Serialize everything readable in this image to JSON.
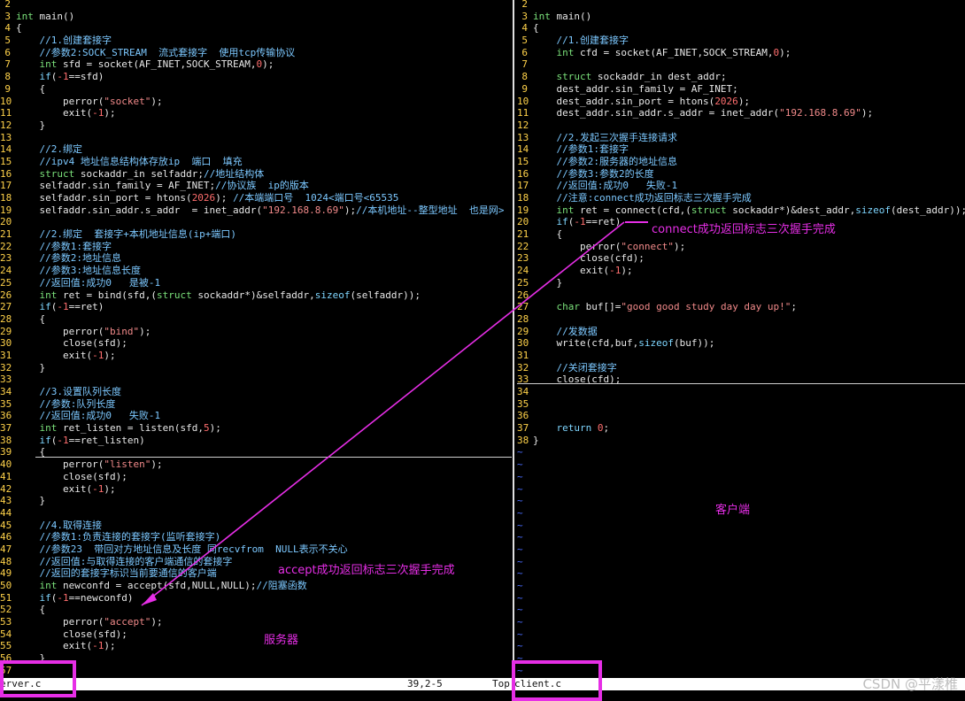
{
  "left": {
    "lines": [
      {
        "n": "2",
        "t": ""
      },
      {
        "n": "3",
        "t": "int main()"
      },
      {
        "n": "4",
        "t": "{"
      },
      {
        "n": "5",
        "t": "    //1.创建套接字"
      },
      {
        "n": "6",
        "t": "    //参数2:SOCK_STREAM  流式套接字  使用tcp传输协议"
      },
      {
        "n": "7",
        "t": "    int sfd = socket(AF_INET,SOCK_STREAM,0);"
      },
      {
        "n": "8",
        "t": "    if(-1==sfd)"
      },
      {
        "n": "9",
        "t": "    {"
      },
      {
        "n": "10",
        "t": "        perror(\"socket\");"
      },
      {
        "n": "11",
        "t": "        exit(-1);"
      },
      {
        "n": "12",
        "t": "    }"
      },
      {
        "n": "13",
        "t": ""
      },
      {
        "n": "14",
        "t": "    //2.绑定"
      },
      {
        "n": "15",
        "t": "    //ipv4 地址信息结构体存放ip  端口  填充"
      },
      {
        "n": "16",
        "t": "    struct sockaddr_in selfaddr;//地址结构体"
      },
      {
        "n": "17",
        "t": "    selfaddr.sin_family = AF_INET;//协议族  ip的版本"
      },
      {
        "n": "18",
        "t": "    selfaddr.sin_port = htons(2026); //本端端口号  1024<端口号<65535"
      },
      {
        "n": "19",
        "t": "    selfaddr.sin_addr.s_addr  = inet_addr(\"192.168.8.69\");//本机地址--整型地址  也是网>"
      },
      {
        "n": "20",
        "t": ""
      },
      {
        "n": "21",
        "t": "    //2.绑定  套接字+本机地址信息(ip+端口)"
      },
      {
        "n": "22",
        "t": "    //参数1:套接字"
      },
      {
        "n": "23",
        "t": "    //参数2:地址信息"
      },
      {
        "n": "24",
        "t": "    //参数3:地址信息长度"
      },
      {
        "n": "25",
        "t": "    //返回值:成功0   是被-1"
      },
      {
        "n": "26",
        "t": "    int ret = bind(sfd,(struct sockaddr*)&selfaddr,sizeof(selfaddr));"
      },
      {
        "n": "27",
        "t": "    if(-1==ret)"
      },
      {
        "n": "28",
        "t": "    {"
      },
      {
        "n": "29",
        "t": "        perror(\"bind\");"
      },
      {
        "n": "30",
        "t": "        close(sfd);"
      },
      {
        "n": "31",
        "t": "        exit(-1);"
      },
      {
        "n": "32",
        "t": "    }"
      },
      {
        "n": "33",
        "t": ""
      },
      {
        "n": "34",
        "t": "    //3.设置队列长度"
      },
      {
        "n": "35",
        "t": "    //参数:队列长度"
      },
      {
        "n": "36",
        "t": "    //返回值:成功0   失败-1"
      },
      {
        "n": "37",
        "t": "    int ret_listen = listen(sfd,5);"
      },
      {
        "n": "38",
        "t": "    if(-1==ret_listen)"
      },
      {
        "n": "39",
        "t": "    {"
      },
      {
        "n": "40",
        "t": "        perror(\"listen\");"
      },
      {
        "n": "41",
        "t": "        close(sfd);"
      },
      {
        "n": "42",
        "t": "        exit(-1);"
      },
      {
        "n": "43",
        "t": "    }"
      },
      {
        "n": "44",
        "t": ""
      },
      {
        "n": "45",
        "t": "    //4.取得连接"
      },
      {
        "n": "46",
        "t": "    //参数1:负责连接的套接字(监听套接字)"
      },
      {
        "n": "47",
        "t": "    //参数23  带回对方地址信息及长度 同recvfrom  NULL表示不关心"
      },
      {
        "n": "48",
        "t": "    //返回值:与取得连接的客户端通信的套接字"
      },
      {
        "n": "49",
        "t": "    //返回的套接字标识当前要通信的客户端"
      },
      {
        "n": "50",
        "t": "    int newconfd = accept(sfd,NULL,NULL);//阻塞函数"
      },
      {
        "n": "51",
        "t": "    if(-1==newconfd)"
      },
      {
        "n": "52",
        "t": "    {"
      },
      {
        "n": "53",
        "t": "        perror(\"accept\");"
      },
      {
        "n": "54",
        "t": "        close(sfd);"
      },
      {
        "n": "55",
        "t": "        exit(-1);"
      },
      {
        "n": "56",
        "t": "    }"
      },
      {
        "n": "57",
        "t": ""
      }
    ]
  },
  "right": {
    "lines": [
      {
        "n": "2",
        "t": ""
      },
      {
        "n": "3",
        "t": "int main()"
      },
      {
        "n": "4",
        "t": "{"
      },
      {
        "n": "5",
        "t": "    //1.创建套接字"
      },
      {
        "n": "6",
        "t": "    int cfd = socket(AF_INET,SOCK_STREAM,0);"
      },
      {
        "n": "7",
        "t": ""
      },
      {
        "n": "8",
        "t": "    struct sockaddr_in dest_addr;"
      },
      {
        "n": "9",
        "t": "    dest_addr.sin_family = AF_INET;"
      },
      {
        "n": "10",
        "t": "    dest_addr.sin_port = htons(2026);"
      },
      {
        "n": "11",
        "t": "    dest_addr.sin_addr.s_addr = inet_addr(\"192.168.8.69\");"
      },
      {
        "n": "12",
        "t": ""
      },
      {
        "n": "13",
        "t": "    //2.发起三次握手连接请求"
      },
      {
        "n": "14",
        "t": "    //参数1:套接字"
      },
      {
        "n": "15",
        "t": "    //参数2:服务器的地址信息"
      },
      {
        "n": "16",
        "t": "    //参数3:参数2的长度"
      },
      {
        "n": "17",
        "t": "    //返回值:成功0   失败-1"
      },
      {
        "n": "18",
        "t": "    //注意:connect成功返回标志三次握手完成"
      },
      {
        "n": "19",
        "t": "    int ret = connect(cfd,(struct sockaddr*)&dest_addr,sizeof(dest_addr));"
      },
      {
        "n": "20",
        "t": "    if(-1==ret)"
      },
      {
        "n": "21",
        "t": "    {"
      },
      {
        "n": "22",
        "t": "        perror(\"connect\");"
      },
      {
        "n": "23",
        "t": "        close(cfd);"
      },
      {
        "n": "24",
        "t": "        exit(-1);"
      },
      {
        "n": "25",
        "t": "    }"
      },
      {
        "n": "26",
        "t": ""
      },
      {
        "n": "27",
        "t": "    char buf[]=\"good good study day day up!\";"
      },
      {
        "n": "28",
        "t": ""
      },
      {
        "n": "29",
        "t": "    //发数据"
      },
      {
        "n": "30",
        "t": "    write(cfd,buf,sizeof(buf));"
      },
      {
        "n": "31",
        "t": ""
      },
      {
        "n": "32",
        "t": "    //关闭套接字"
      },
      {
        "n": "33",
        "t": "    close(cfd);"
      },
      {
        "n": "34",
        "t": ""
      },
      {
        "n": "35",
        "t": ""
      },
      {
        "n": "36",
        "t": ""
      },
      {
        "n": "37",
        "t": "    return 0;"
      },
      {
        "n": "38",
        "t": "}"
      }
    ],
    "tilde_count": 19
  },
  "statusbar": {
    "left_file": "erver.c",
    "position": "39,2-5",
    "scroll": "Top",
    "right_file": "client.c"
  },
  "annotations": {
    "connect_note": "connect成功返回标志三次握手完成",
    "accept_note": "accept成功返回标志三次握手完成",
    "server_label": "服务器",
    "client_label": "客户端"
  },
  "watermark": "CSDN @平漾椎",
  "colors": {
    "background": "#000000",
    "line_number": "#ffd24a",
    "keyword": "#7fd6ff",
    "comment": "#7cc8ff",
    "string": "#f28a8a",
    "annotation": "#e62ee6"
  }
}
